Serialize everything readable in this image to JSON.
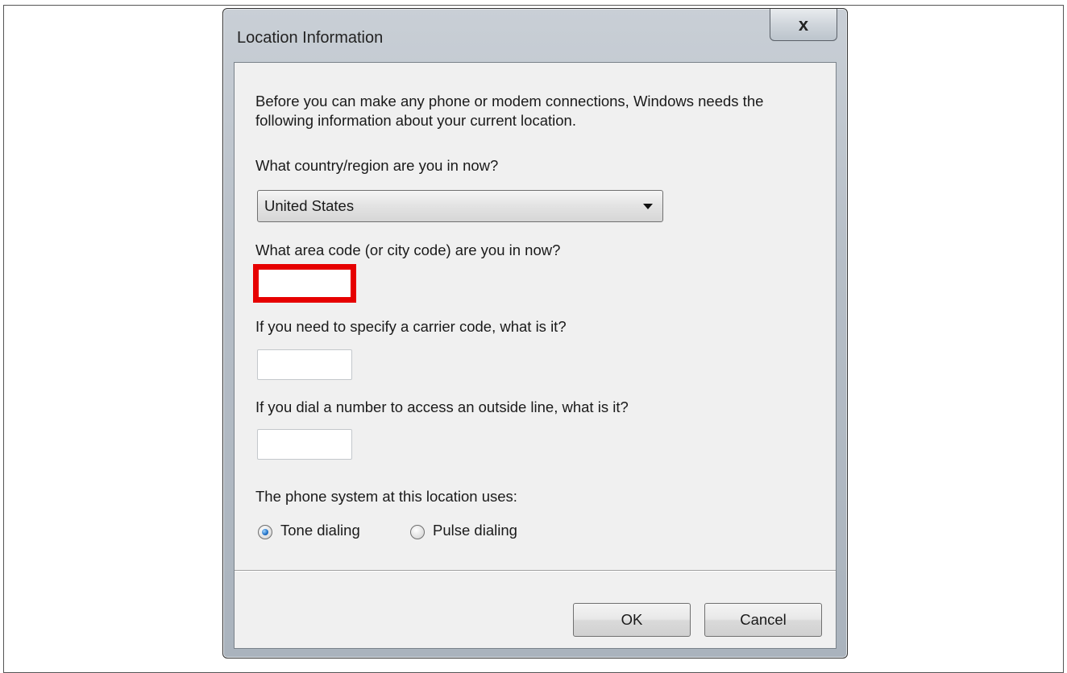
{
  "dialog": {
    "title": "Location Information",
    "close_symbol": "x"
  },
  "intro": "Before you can make any phone or modem connections, Windows needs the following information about your current location.",
  "country": {
    "label": "What country/region are you in now?",
    "selected": "United States"
  },
  "area_code": {
    "label": "What area code (or city code) are you in now?",
    "value": ""
  },
  "carrier_code": {
    "label": "If you need to specify a carrier code, what is it?",
    "value": ""
  },
  "outside_line": {
    "label": "If you dial a number to access an outside line, what is it?",
    "value": ""
  },
  "phone_system": {
    "label": "The phone system at this location uses:",
    "options": [
      {
        "label": "Tone dialing",
        "checked": true
      },
      {
        "label": "Pulse dialing",
        "checked": false
      }
    ]
  },
  "buttons": {
    "ok": "OK",
    "cancel": "Cancel"
  },
  "highlight_color": "#e60000"
}
